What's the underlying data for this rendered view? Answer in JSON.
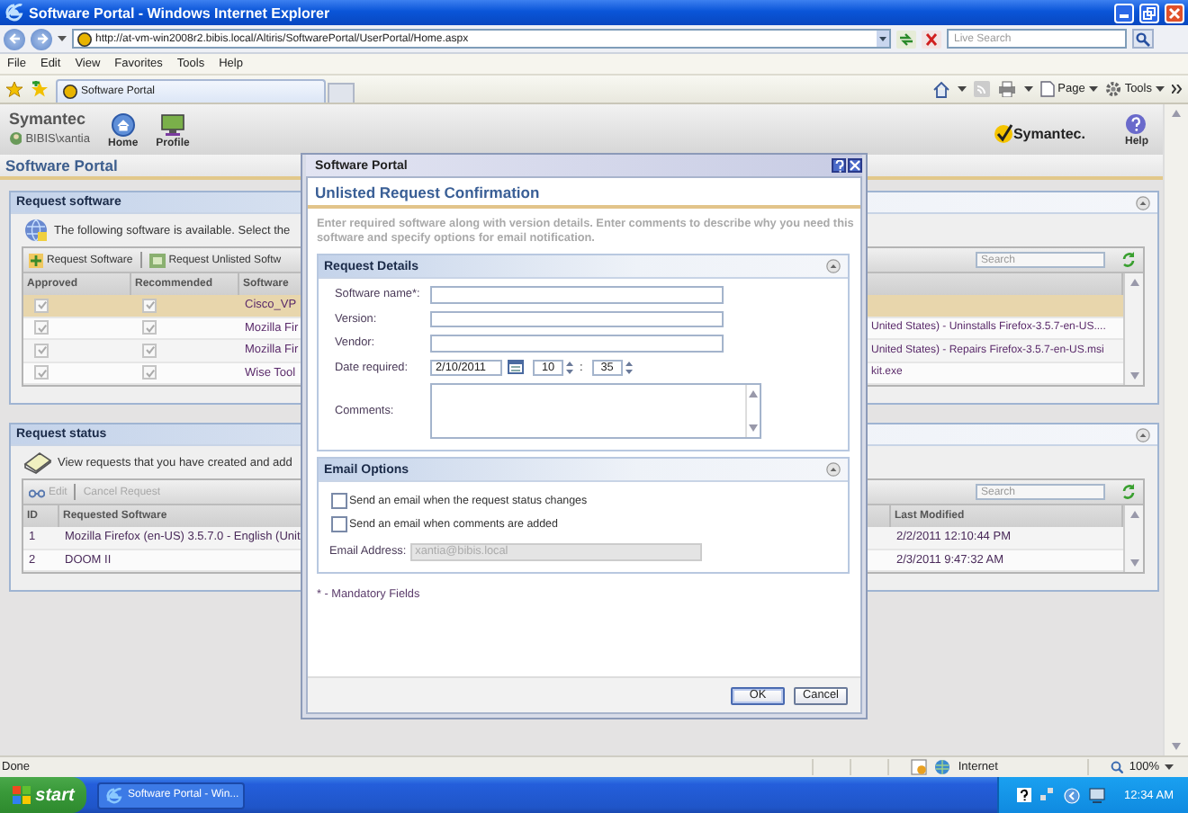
{
  "window": {
    "title": "Software Portal - Windows Internet Explorer"
  },
  "address_bar": {
    "url": "http://at-vm-win2008r2.bibis.local/Altiris/SoftwarePortal/UserPortal/Home.aspx"
  },
  "search_box": {
    "placeholder": "Live Search"
  },
  "menu": [
    "File",
    "Edit",
    "View",
    "Favorites",
    "Tools",
    "Help"
  ],
  "browser_tab": {
    "title": "Software Portal"
  },
  "command_bar": [
    "Page",
    "Tools"
  ],
  "portal_header": {
    "brand": "Symantec",
    "user": "BIBIS\\xantia",
    "nav": [
      "Home",
      "Profile"
    ],
    "logo": "Symantec.",
    "help": "Help"
  },
  "page_title": "Software Portal",
  "request_software": {
    "title": "Request software",
    "info": "The following software is available. Select the",
    "toolbar": [
      "Request Software",
      "Request Unlisted Softw"
    ],
    "search": {
      "placeholder": "Search"
    },
    "columns": [
      "Approved",
      "Recommended",
      "Software"
    ],
    "rows": [
      {
        "approved": true,
        "recommended": true,
        "software": "Cisco_VP",
        "selected": true
      },
      {
        "approved": true,
        "recommended": true,
        "software": "Mozilla Fir",
        "detail": "United States) - Uninstalls Firefox-3.5.7-en-US....",
        "selected": false
      },
      {
        "approved": true,
        "recommended": true,
        "software": "Mozilla Fir",
        "detail": "United States) - Repairs Firefox-3.5.7-en-US.msi",
        "selected": false
      },
      {
        "approved": true,
        "recommended": true,
        "software": "Wise Tool",
        "detail": "kit.exe",
        "selected": false
      }
    ]
  },
  "request_status": {
    "title": "Request status",
    "info": "View requests that you have created and add",
    "toolbar": [
      {
        "label": "Edit",
        "disabled": true
      },
      {
        "label": "Cancel Request",
        "disabled": true
      }
    ],
    "search": {
      "placeholder": "Search"
    },
    "columns": [
      "ID",
      "Requested Software",
      "Last Modified"
    ],
    "rows": [
      {
        "id": "1",
        "software": "Mozilla Firefox (en-US) 3.5.7.0 - English (Unit",
        "modified": "2/2/2011 12:10:44 PM"
      },
      {
        "id": "2",
        "software": "DOOM II",
        "modified": "2/3/2011 9:47:32 AM"
      }
    ]
  },
  "dialog": {
    "title": "Software Portal",
    "heading": "Unlisted Request Confirmation",
    "description": "Enter required software along with version details. Enter comments to describe why you need this software and specify options for email notification.",
    "details": {
      "title": "Request Details",
      "fields": [
        {
          "kind": "text",
          "label": "Software name*:"
        },
        {
          "kind": "text",
          "label": "Version:"
        },
        {
          "kind": "text",
          "label": "Vendor:"
        },
        {
          "kind": "date",
          "label": "Date required:",
          "value": "2/10/2011",
          "hour": "10",
          "separator": ":",
          "minute": "35"
        },
        {
          "kind": "textarea",
          "label": "Comments:"
        }
      ]
    },
    "email": {
      "title": "Email Options",
      "options": [
        {
          "label": "Send an email when the request status changes",
          "checked": false
        },
        {
          "label": "Send an email when comments are added",
          "checked": false
        }
      ],
      "address": {
        "label": "Email Address:",
        "value": "xantia@bibis.local",
        "disabled": true
      }
    },
    "mandatory_note": "* - Mandatory Fields",
    "buttons": [
      "OK",
      "Cancel"
    ]
  },
  "status_bar": {
    "text": "Done",
    "zone": "Internet",
    "zoom": "100%"
  },
  "taskbar": {
    "start": "start",
    "task": "Software Portal - Win...",
    "clock": "12:34 AM"
  }
}
